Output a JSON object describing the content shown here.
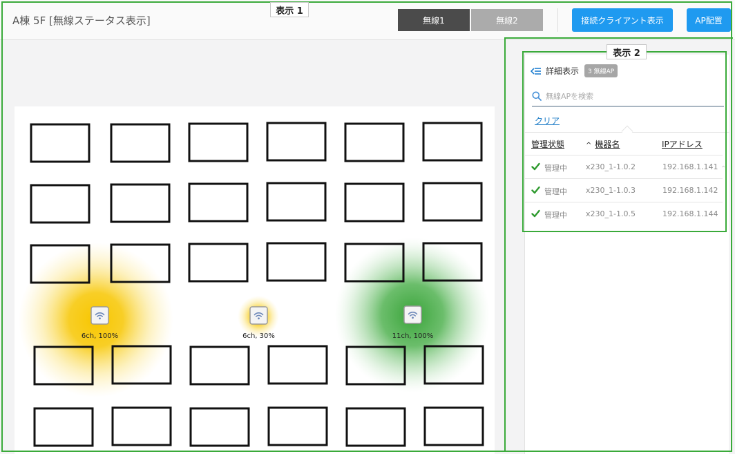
{
  "header": {
    "title": "A棟 5F [無線ステータス表示]",
    "radio_tabs": [
      "無線1",
      "無線2"
    ],
    "show_clients_label": "接続クライアント表示",
    "ap_place_label": "AP配置"
  },
  "annotations": {
    "view1": "表示 1",
    "view2": "表示 2"
  },
  "map": {
    "aps": [
      {
        "label": "6ch, 100%",
        "color": "#f7c600",
        "signal_percent": 100
      },
      {
        "label": "6ch, 30%",
        "color": "#f7c600",
        "signal_percent": 30
      },
      {
        "label": "11ch, 100%",
        "color": "#2f9e2f",
        "signal_percent": 100
      }
    ]
  },
  "panel": {
    "title": "詳細表示",
    "badge": "3 無線AP",
    "search_placeholder": "無線APを検索",
    "clear_label": "クリア",
    "columns": {
      "status": "管理状態",
      "name": "機器名",
      "ip": "IPアドレス"
    },
    "sort_indicator": "^",
    "rows": [
      {
        "status": "管理中",
        "name": "x230_1-1.0.2",
        "ip": "192.168.1.141"
      },
      {
        "status": "管理中",
        "name": "x230_1-1.0.3",
        "ip": "192.168.1.142"
      },
      {
        "status": "管理中",
        "name": "x230_1-1.0.5",
        "ip": "192.168.1.144"
      }
    ]
  },
  "colors": {
    "accent": "#1f9af0",
    "check": "#2e9a2e",
    "annotation": "#3aaa3a"
  }
}
